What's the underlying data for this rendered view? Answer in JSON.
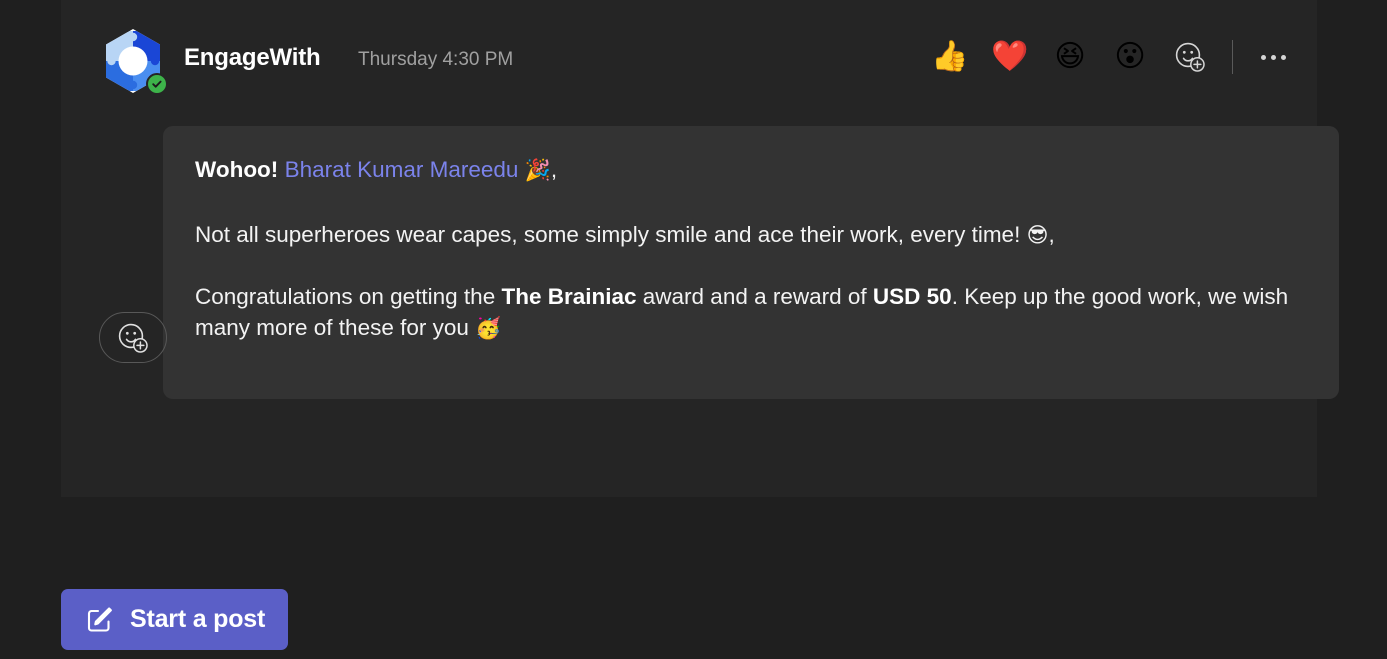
{
  "message": {
    "sender": "EngageWith",
    "timestamp": "Thursday 4:30 PM",
    "avatar_icon": "engagewith-puzzle-logo",
    "presence_icon": "available-check-badge",
    "reactions": [
      {
        "name": "thumbs-up-reaction",
        "glyph": "👍",
        "label": "Like"
      },
      {
        "name": "heart-reaction",
        "glyph": "❤️",
        "label": "Heart"
      },
      {
        "name": "laugh-reaction",
        "glyph": "😆",
        "label": "Laugh"
      },
      {
        "name": "surprised-reaction",
        "glyph": "😮",
        "label": "Surprised"
      }
    ],
    "add_reaction_label": "Add a reaction",
    "more_options_label": "More options",
    "card": {
      "greeting_prefix": "Wohoo!",
      "mention": "Bharat Kumar Mareedu",
      "greeting_emoji": "🎉",
      "greeting_suffix": ",",
      "line2_text": "Not all superheroes wear capes, some simply smile and ace their work, every time!",
      "line2_emoji": "😎",
      "line2_suffix": ",",
      "line3_part1": "Congratulations on getting the ",
      "line3_award": "The Brainiac",
      "line3_part2": " award and a reward of ",
      "line3_amount": "USD 50",
      "line3_part3": ". Keep up the good work, we wish many more of these for you ",
      "line3_emoji": "🥳"
    },
    "footer_add_reaction_label": "Add a reaction"
  },
  "composer": {
    "start_post_label": "Start a post",
    "start_post_icon": "compose-edit-icon"
  },
  "colors": {
    "page_background": "#1f1f1f",
    "message_background": "#252525",
    "card_background": "#333333",
    "mention": "#7b83eb",
    "accent_button": "#5b5fc7",
    "presence_green": "#3db34a"
  }
}
